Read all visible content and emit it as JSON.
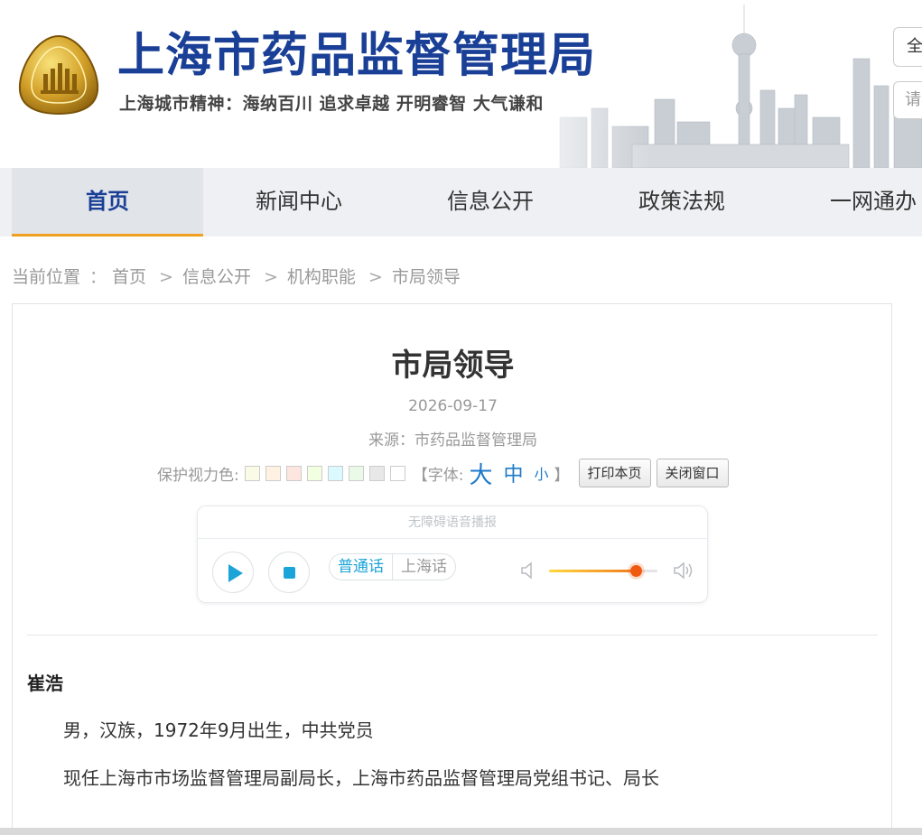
{
  "header": {
    "title": "上海市药品监督管理局",
    "slogan": "上海城市精神：海纳百川  追求卓越  开明睿智  大气谦和",
    "top_button": "全",
    "search_placeholder": "请"
  },
  "nav": {
    "items": [
      {
        "label": "首页",
        "active": true
      },
      {
        "label": "新闻中心"
      },
      {
        "label": "信息公开"
      },
      {
        "label": "政策法规"
      },
      {
        "label": "一网通办"
      }
    ]
  },
  "breadcrumb": {
    "prefix": "当前位置",
    "colon": "：",
    "items": [
      "首页",
      "信息公开",
      "机构职能",
      "市局领导"
    ],
    "separator": ">"
  },
  "article": {
    "title": "市局领导",
    "date": "2026-09-17",
    "source": "来源：市药品监督管理局",
    "eye_color_label": "保护视力色:",
    "swatch_colors": [
      "#fafbe6",
      "#fff2e2",
      "#fde6e0",
      "#f3ffe1",
      "#dafaff",
      "#eafae6",
      "#e8e8e8",
      "#ffffff"
    ],
    "font_label": "【字体:",
    "font_big": "大",
    "font_mid": "中",
    "font_small": "小",
    "font_close": "】",
    "print_button": "打印本页",
    "close_button": "关闭窗口"
  },
  "player": {
    "title": "无障碍语音播报",
    "lang_mandarin": "普通话",
    "lang_shanghai": "上海话",
    "volume_level": 0.8
  },
  "content": {
    "name": "崔浩",
    "line1": "男，汉族，1972年9月出生，中共党员",
    "line2": "现任上海市市场监督管理局副局长，上海市药品监督管理局党组书记、局长"
  },
  "colors": {
    "brand_blue": "#1a3f96",
    "accent_orange": "#f0a020",
    "link_blue": "#1e7ac8",
    "player_cyan": "#1ba4d8"
  }
}
